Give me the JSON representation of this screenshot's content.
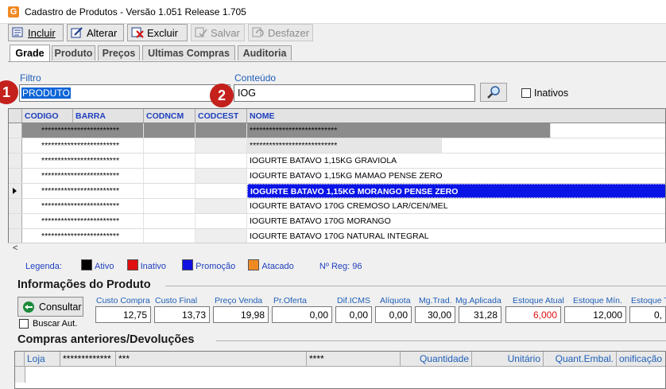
{
  "window": {
    "app_icon_letter": "G",
    "title": "Cadastro de Produtos - Versão 1.051 Release 1.705"
  },
  "toolbar": {
    "incluir": "Incluir",
    "alterar": "Alterar",
    "excluir": "Excluir",
    "salvar": "Salvar",
    "desfazer": "Desfazer"
  },
  "tabs": [
    "Grade",
    "Produto",
    "Preços",
    "Ultimas Compras",
    "Auditoria"
  ],
  "filter": {
    "filtro_label": "Filtro",
    "filtro_value": "PRODUTO",
    "conteudo_label": "Conteúdo",
    "conteudo_value": "IOG",
    "inativos_label": "Inativos",
    "badge1": "1",
    "badge2": "2"
  },
  "grid": {
    "headers": [
      "CODIGO",
      "BARRA",
      "CODNCM",
      "CODCEST",
      "NOME"
    ],
    "masked_codigo_barra": "************************",
    "masked_nome": "***************************",
    "rows": [
      {
        "nome": "***************************",
        "masked": true
      },
      {
        "nome": "***************************",
        "masked": true
      },
      {
        "nome": "IOGURTE BATAVO 1,15KG GRAVIOLA"
      },
      {
        "nome": "IOGURTE BATAVO 1,15KG MAMAO PENSE ZERO"
      },
      {
        "nome": "IOGURTE BATAVO 1,15KG MORANGO PENSE ZERO",
        "selected": true
      },
      {
        "nome": "IOGURTE BATAVO 170G CREMOSO LAR/CEN/MEL"
      },
      {
        "nome": "IOGURTE BATAVO 170G MORANGO"
      },
      {
        "nome": "IOGURTE BATAVO 170G NATURAL INTEGRAL"
      }
    ]
  },
  "legend": {
    "label": "Legenda:",
    "items": [
      {
        "label": "Ativo",
        "color": "#000000"
      },
      {
        "label": "Inativo",
        "color": "#e01010"
      },
      {
        "label": "Promoção",
        "color": "#1010e0"
      },
      {
        "label": "Atacado",
        "color": "#f08a24"
      }
    ],
    "nreg": "Nº Reg: 96"
  },
  "info": {
    "title": "Informações do Produto",
    "consultar": "Consultar",
    "buscar_aut": "Buscar Aut.",
    "fields": [
      {
        "label": "Custo Compra",
        "value": "12,75"
      },
      {
        "label": "Custo Final",
        "value": "13,73"
      },
      {
        "label": "Preço Venda",
        "value": "19,98"
      },
      {
        "label": "Pr.Oferta",
        "value": "0,00"
      },
      {
        "label": "Dif.ICMS",
        "value": "0,00"
      },
      {
        "label": "Alíquota",
        "value": "0,00"
      },
      {
        "label": "Mg.Trad.",
        "value": "30,00"
      },
      {
        "label": "Mg.Aplicada",
        "value": "31,28"
      },
      {
        "label": "Estoque Atual",
        "value": "6,000",
        "color": "#e01010"
      },
      {
        "label": "Estoque Mín.",
        "value": "12,000"
      },
      {
        "label": "Estoque T",
        "value": "0,"
      }
    ]
  },
  "compras": {
    "title": "Compras anteriores/Devoluções",
    "headers": [
      "Loja",
      "*************",
      "***",
      "****",
      "Quantidade",
      "Unitário",
      "Quant.Embal.",
      "onificação"
    ]
  },
  "colors": {
    "selection": "#0a14e6",
    "header_text": "#1f3fbf",
    "badge": "#c4201c"
  }
}
